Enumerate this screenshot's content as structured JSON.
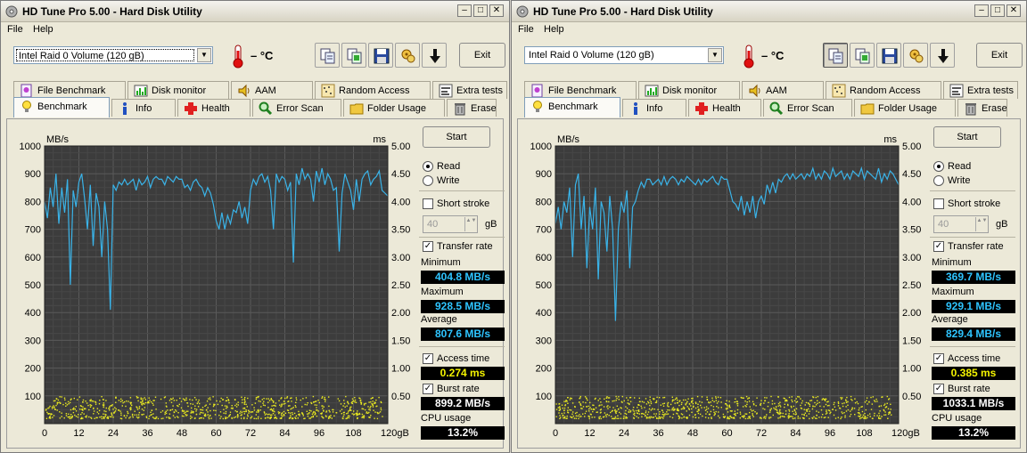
{
  "windows": [
    {
      "id": "left",
      "title": "HD Tune Pro 5.00 - Hard Disk Utility",
      "menu": [
        "File",
        "Help"
      ],
      "drive": "Intel   Raid 0 Volume (120 gB)",
      "temperature": "– °C",
      "exit_label": "Exit",
      "tabs_top": [
        "File Benchmark",
        "Disk monitor",
        "AAM",
        "Random Access",
        "Extra tests"
      ],
      "tabs_bottom": [
        "Benchmark",
        "Info",
        "Health",
        "Error Scan",
        "Folder Usage",
        "Erase"
      ],
      "active_tab": "Benchmark",
      "start_label": "Start",
      "read_label": "Read",
      "write_label": "Write",
      "short_stroke_label": "Short stroke",
      "short_stroke_value": "40",
      "gb_unit": "gB",
      "transfer_rate_label": "Transfer rate",
      "minimum_label": "Minimum",
      "minimum": "404.8 MB/s",
      "maximum_label": "Maximum",
      "maximum": "928.5 MB/s",
      "average_label": "Average",
      "average": "807.6 MB/s",
      "access_time_label": "Access time",
      "access_time": "0.274 ms",
      "burst_rate_label": "Burst rate",
      "burst_rate": "899.2 MB/s",
      "cpu_usage_label": "CPU usage",
      "cpu_usage": "13.2%",
      "options": {
        "read": true,
        "short_stroke": false,
        "transfer_rate": true,
        "access_time": true,
        "burst_rate": true
      }
    },
    {
      "id": "right",
      "title": "HD Tune Pro 5.00 - Hard Disk Utility",
      "menu": [
        "File",
        "Help"
      ],
      "drive": "Intel   Raid 0 Volume (120 gB)",
      "temperature": "– °C",
      "exit_label": "Exit",
      "tabs_top": [
        "File Benchmark",
        "Disk monitor",
        "AAM",
        "Random Access",
        "Extra tests"
      ],
      "tabs_bottom": [
        "Benchmark",
        "Info",
        "Health",
        "Error Scan",
        "Folder Usage",
        "Erase"
      ],
      "active_tab": "Benchmark",
      "start_label": "Start",
      "read_label": "Read",
      "write_label": "Write",
      "short_stroke_label": "Short stroke",
      "short_stroke_value": "40",
      "gb_unit": "gB",
      "transfer_rate_label": "Transfer rate",
      "minimum_label": "Minimum",
      "minimum": "369.7 MB/s",
      "maximum_label": "Maximum",
      "maximum": "929.1 MB/s",
      "average_label": "Average",
      "average": "829.4 MB/s",
      "access_time_label": "Access time",
      "access_time": "0.385 ms",
      "burst_rate_label": "Burst rate",
      "burst_rate": "1033.1 MB/s",
      "cpu_usage_label": "CPU usage",
      "cpu_usage": "13.2%",
      "options": {
        "read": true,
        "short_stroke": false,
        "transfer_rate": true,
        "access_time": true,
        "burst_rate": true
      }
    }
  ],
  "chart_data": [
    {
      "type": "line",
      "ylabel": "MB/s",
      "y2label": "ms",
      "ylim": [
        0,
        1000
      ],
      "y2lim": [
        0,
        5
      ],
      "yticks": [
        "100",
        "200",
        "300",
        "400",
        "500",
        "600",
        "700",
        "800",
        "900",
        "1000"
      ],
      "y2ticks": [
        "0.50",
        "1.00",
        "1.50",
        "2.00",
        "2.50",
        "3.00",
        "3.50",
        "4.00",
        "4.50",
        "5.00"
      ],
      "xticks": [
        "0",
        "12",
        "24",
        "36",
        "48",
        "60",
        "72",
        "84",
        "96",
        "108",
        "120gB"
      ],
      "xlim": [
        0,
        120
      ],
      "grid": true,
      "series": [
        {
          "name": "Transfer rate",
          "color": "#3ab3e8",
          "x": [
            0,
            1,
            2,
            3,
            4,
            5,
            6,
            7,
            8,
            9,
            10,
            11,
            12,
            13,
            14,
            15,
            16,
            17,
            18,
            19,
            20,
            21,
            22,
            23,
            24,
            25,
            26,
            27,
            28,
            29,
            30,
            31,
            32,
            33,
            34,
            35,
            36,
            37,
            38,
            39,
            40,
            41,
            42,
            43,
            44,
            45,
            46,
            47,
            48,
            49,
            50,
            51,
            52,
            53,
            54,
            55,
            56,
            57,
            58,
            59,
            60,
            61,
            62,
            63,
            64,
            65,
            66,
            67,
            68,
            69,
            70,
            71,
            72,
            73,
            74,
            75,
            76,
            77,
            78,
            79,
            80,
            81,
            82,
            83,
            84,
            85,
            86,
            87,
            88,
            89,
            90,
            91,
            92,
            93,
            94,
            95,
            96,
            97,
            98,
            99,
            100,
            101,
            102,
            103,
            104,
            105,
            106,
            107,
            108,
            109,
            110,
            111,
            112,
            113,
            114,
            115,
            116,
            117,
            118,
            119,
            120
          ],
          "values": [
            800,
            740,
            850,
            780,
            900,
            720,
            850,
            760,
            880,
            500,
            840,
            780,
            870,
            900,
            810,
            700,
            860,
            640,
            830,
            780,
            600,
            800,
            700,
            410,
            860,
            840,
            870,
            860,
            880,
            860,
            870,
            880,
            840,
            880,
            860,
            870,
            890,
            850,
            880,
            890,
            880,
            880,
            860,
            890,
            880,
            870,
            890,
            880,
            880,
            850,
            860,
            840,
            870,
            880,
            860,
            850,
            820,
            850,
            830,
            790,
            730,
            700,
            760,
            700,
            750,
            720,
            770,
            760,
            800,
            740,
            780,
            720,
            840,
            880,
            860,
            890,
            900,
            870,
            890,
            840,
            700,
            900,
            870,
            890,
            880,
            840,
            870,
            580,
            900,
            860,
            920,
            880,
            900,
            880,
            800,
            910,
            870,
            920,
            860,
            900,
            880,
            840,
            850,
            620,
            830,
            900,
            870,
            840,
            770,
            880,
            800,
            880,
            900,
            910,
            860,
            880,
            890,
            910,
            840,
            830,
            820
          ]
        },
        {
          "name": "Access time",
          "color": "#eaea20",
          "type": "scatter",
          "value_range_ms": [
            0.1,
            0.5
          ]
        }
      ]
    },
    {
      "type": "line",
      "ylabel": "MB/s",
      "y2label": "ms",
      "ylim": [
        0,
        1000
      ],
      "y2lim": [
        0,
        5
      ],
      "yticks": [
        "100",
        "200",
        "300",
        "400",
        "500",
        "600",
        "700",
        "800",
        "900",
        "1000"
      ],
      "y2ticks": [
        "0.50",
        "1.00",
        "1.50",
        "2.00",
        "2.50",
        "3.00",
        "3.50",
        "4.00",
        "4.50",
        "5.00"
      ],
      "xticks": [
        "0",
        "12",
        "24",
        "36",
        "48",
        "60",
        "72",
        "84",
        "96",
        "108",
        "120gB"
      ],
      "xlim": [
        0,
        120
      ],
      "grid": true,
      "series": [
        {
          "name": "Transfer rate",
          "color": "#3ab3e8",
          "x": [
            0,
            1,
            2,
            3,
            4,
            5,
            6,
            7,
            8,
            9,
            10,
            11,
            12,
            13,
            14,
            15,
            16,
            17,
            18,
            19,
            20,
            21,
            22,
            23,
            24,
            25,
            26,
            27,
            28,
            29,
            30,
            31,
            32,
            33,
            34,
            35,
            36,
            37,
            38,
            39,
            40,
            41,
            42,
            43,
            44,
            45,
            46,
            47,
            48,
            49,
            50,
            51,
            52,
            53,
            54,
            55,
            56,
            57,
            58,
            59,
            60,
            61,
            62,
            63,
            64,
            65,
            66,
            67,
            68,
            69,
            70,
            71,
            72,
            73,
            74,
            75,
            76,
            77,
            78,
            79,
            80,
            81,
            82,
            83,
            84,
            85,
            86,
            87,
            88,
            89,
            90,
            91,
            92,
            93,
            94,
            95,
            96,
            97,
            98,
            99,
            100,
            101,
            102,
            103,
            104,
            105,
            106,
            107,
            108,
            109,
            110,
            111,
            112,
            113,
            114,
            115,
            116,
            117,
            118,
            119,
            120
          ],
          "values": [
            720,
            780,
            700,
            800,
            760,
            850,
            600,
            860,
            900,
            700,
            820,
            560,
            780,
            700,
            850,
            520,
            800,
            760,
            620,
            820,
            700,
            370,
            700,
            800,
            760,
            840,
            560,
            780,
            800,
            840,
            870,
            850,
            880,
            880,
            860,
            870,
            880,
            860,
            890,
            860,
            880,
            890,
            880,
            860,
            880,
            870,
            890,
            880,
            870,
            860,
            880,
            860,
            880,
            870,
            880,
            890,
            870,
            860,
            890,
            880,
            880,
            840,
            800,
            790,
            770,
            820,
            750,
            800,
            760,
            820,
            740,
            800,
            820,
            790,
            860,
            830,
            870,
            830,
            880,
            870,
            890,
            900,
            880,
            900,
            880,
            890,
            900,
            880,
            900,
            890,
            920,
            880,
            900,
            880,
            910,
            900,
            880,
            920,
            890,
            900,
            910,
            880,
            900,
            880,
            910,
            900,
            890,
            920,
            880,
            910,
            900,
            890,
            880,
            920,
            870,
            900,
            880,
            910,
            900,
            880,
            860
          ]
        },
        {
          "name": "Access time",
          "color": "#eaea20",
          "type": "scatter",
          "value_range_ms": [
            0.1,
            0.5
          ]
        }
      ]
    }
  ]
}
